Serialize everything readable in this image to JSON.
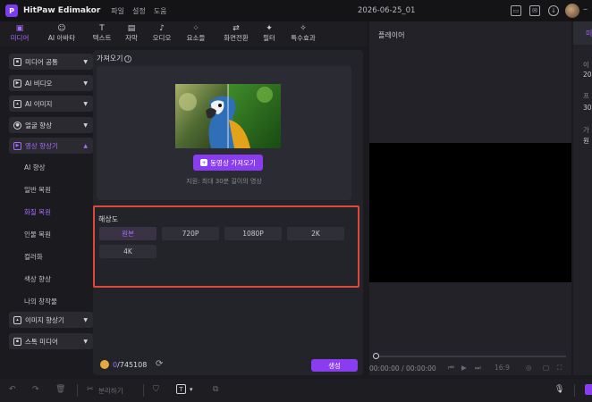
{
  "app": {
    "title": "HitPaw Edimakor",
    "logo_letter": "P",
    "menu": [
      "파일",
      "설정",
      "도움"
    ],
    "project_name": "2026-06-25_01",
    "accent_color": "#8a3cf0"
  },
  "tabs": [
    {
      "label": "미디어",
      "icon": "folder-icon",
      "glyph": "▣"
    },
    {
      "label": "AI 아바타",
      "icon": "avatar-icon",
      "glyph": "☺"
    },
    {
      "label": "텍스트",
      "icon": "text-icon",
      "glyph": "T"
    },
    {
      "label": "자막",
      "icon": "subtitle-icon",
      "glyph": "▤"
    },
    {
      "label": "오디오",
      "icon": "audio-icon",
      "glyph": "♪"
    },
    {
      "label": "요소들",
      "icon": "elements-icon",
      "glyph": "⁘"
    },
    {
      "label": "화면전환",
      "icon": "transition-icon",
      "glyph": "⇄"
    },
    {
      "label": "필터",
      "icon": "filter-icon",
      "glyph": "✦"
    },
    {
      "label": "특수효과",
      "icon": "effects-icon",
      "glyph": "✧"
    }
  ],
  "sidebar": {
    "items": [
      {
        "label": "미디어 공통",
        "icon": "folder-icon"
      },
      {
        "label": "AI 비디오",
        "icon": "ai-video-icon"
      },
      {
        "label": "AI  이미지",
        "icon": "ai-image-icon"
      },
      {
        "label": "얼굴 향상",
        "icon": "face-icon"
      },
      {
        "label": "영상 향상기",
        "icon": "video-enhance-icon"
      },
      {
        "label": "이미지 향상기",
        "icon": "image-enhance-icon"
      },
      {
        "label": "스톡 미디어",
        "icon": "stock-icon"
      }
    ],
    "sub_items": [
      "AI 향상",
      "일반 복원",
      "화질 복원",
      "인물 복원",
      "컬러화",
      "색상 향상",
      "나의 창작물"
    ]
  },
  "panel": {
    "title": "가져오기",
    "import_button": "동영상 가져오기",
    "limit_note": "지원: 최대 30분 길이의 영상",
    "resolution_label": "해상도",
    "resolutions": [
      "원본",
      "720P",
      "1080P",
      "2K",
      "4K"
    ],
    "credits_used": "0",
    "credits_total": "/745108",
    "generate_button": "생성"
  },
  "player": {
    "title": "플레이어",
    "timecode": "00:00:00 / 00:00:00",
    "aspect": "16:9"
  },
  "right_panel": {
    "texts": [
      "이",
      "20",
      "프",
      "30",
      "가",
      "원"
    ]
  },
  "bottom_bar": {
    "split_label": "분리하기"
  }
}
